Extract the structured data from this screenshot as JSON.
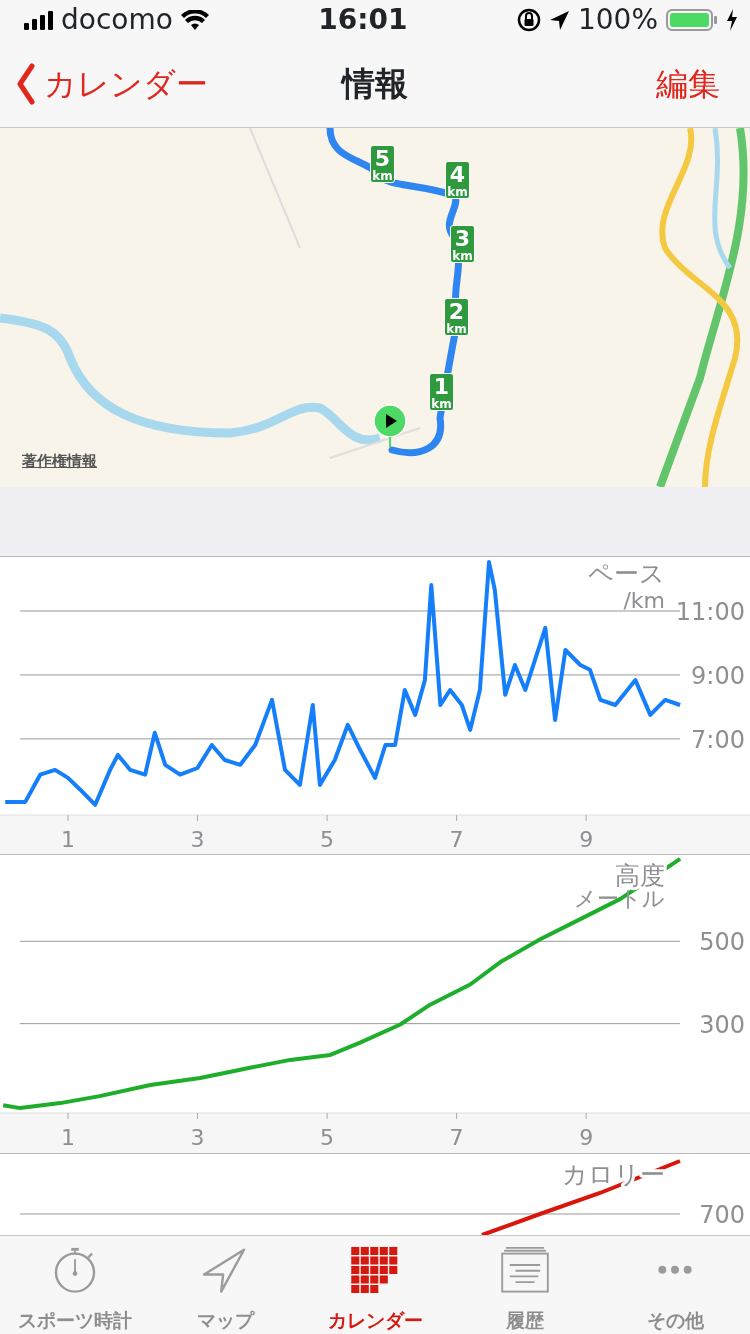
{
  "status_bar": {
    "carrier": "docomo",
    "time": "16:01",
    "battery": "100%"
  },
  "nav_bar": {
    "back": "カレンダー",
    "title": "情報",
    "action": "編集"
  },
  "map": {
    "distance_markers": [
      {
        "value": "5",
        "unit": "km"
      },
      {
        "value": "4",
        "unit": "km"
      },
      {
        "value": "3",
        "unit": "km"
      },
      {
        "value": "2",
        "unit": "km"
      },
      {
        "value": "1",
        "unit": "km"
      }
    ],
    "copyright_link": "著作権情報"
  },
  "pace_chart": {
    "chart_data": {
      "type": "line",
      "title": "ペース",
      "ylabel": "/km",
      "grid": true,
      "xlim": [
        -0.05,
        11.53
      ],
      "ylim": [
        4.62,
        12.72
      ],
      "xticks": [
        1,
        3,
        5,
        7,
        9
      ],
      "yticks": [
        {
          "value": 7,
          "label": "7:00"
        },
        {
          "value": 9,
          "label": "9:00"
        },
        {
          "value": 11,
          "label": "11:00"
        }
      ],
      "x": [
        0.03,
        0.34,
        0.57,
        0.8,
        1.0,
        1.19,
        1.42,
        1.65,
        1.77,
        1.96,
        2.19,
        2.34,
        2.5,
        2.73,
        3.0,
        3.22,
        3.42,
        3.66,
        3.89,
        4.15,
        4.35,
        4.58,
        4.78,
        4.89,
        5.12,
        5.32,
        5.51,
        5.74,
        5.9,
        6.05,
        6.2,
        6.36,
        6.51,
        6.61,
        6.75,
        6.9,
        7.08,
        7.21,
        7.36,
        7.5,
        7.59,
        7.75,
        7.9,
        8.06,
        8.21,
        8.37,
        8.52,
        8.68,
        8.91,
        9.06,
        9.22,
        9.45,
        9.76,
        9.99,
        10.22,
        10.45
      ],
      "series": [
        {
          "color": "#147efb",
          "values": [
            5.03,
            5.03,
            5.88,
            6.03,
            5.78,
            5.41,
            4.94,
            6.03,
            6.5,
            6.03,
            5.88,
            7.19,
            6.19,
            5.88,
            6.09,
            6.81,
            6.34,
            6.19,
            6.81,
            8.22,
            6.03,
            5.56,
            8.06,
            5.56,
            6.34,
            7.44,
            6.66,
            5.78,
            6.81,
            6.81,
            8.53,
            7.75,
            8.84,
            11.81,
            8.06,
            8.53,
            8.06,
            7.28,
            8.53,
            12.53,
            11.66,
            8.38,
            9.31,
            8.53,
            9.47,
            10.47,
            7.59,
            9.78,
            9.31,
            9.16,
            8.22,
            8.06,
            8.84,
            7.75,
            8.22,
            8.06
          ]
        }
      ]
    }
  },
  "altitude_chart": {
    "chart_data": {
      "type": "line",
      "title": "高度",
      "ylabel": "メートル",
      "grid": true,
      "xlim": [
        -0.05,
        11.53
      ],
      "ylim": [
        83,
        712
      ],
      "xticks": [
        1,
        3,
        5,
        7,
        9
      ],
      "yticks": [
        {
          "value": 300,
          "label": "300"
        },
        {
          "value": 500,
          "label": "500"
        }
      ],
      "x": [
        0,
        0.26,
        0.88,
        1.49,
        2.27,
        3.04,
        3.81,
        4.43,
        5.05,
        5.51,
        6.13,
        6.59,
        7.21,
        7.67,
        8.29,
        8.91,
        9.53,
        10.45
      ],
      "series": [
        {
          "color": "#1fae2b",
          "values": [
            102,
            95,
            107,
            124,
            151,
            168,
            193,
            212,
            224,
            254,
            298,
            346,
            395,
            449,
            505,
            554,
            603,
            700
          ]
        }
      ]
    }
  },
  "calorie_chart": {
    "title": "カロリー",
    "tick_label": "700"
  },
  "tab_bar": [
    {
      "label": "スポーツ時計",
      "kind": "stopwatch",
      "selected": false
    },
    {
      "label": "マップ",
      "kind": "map",
      "selected": false
    },
    {
      "label": "カレンダー",
      "kind": "calendar",
      "selected": true
    },
    {
      "label": "履歴",
      "kind": "history",
      "selected": false
    },
    {
      "label": "その他",
      "kind": "more",
      "selected": false
    }
  ]
}
